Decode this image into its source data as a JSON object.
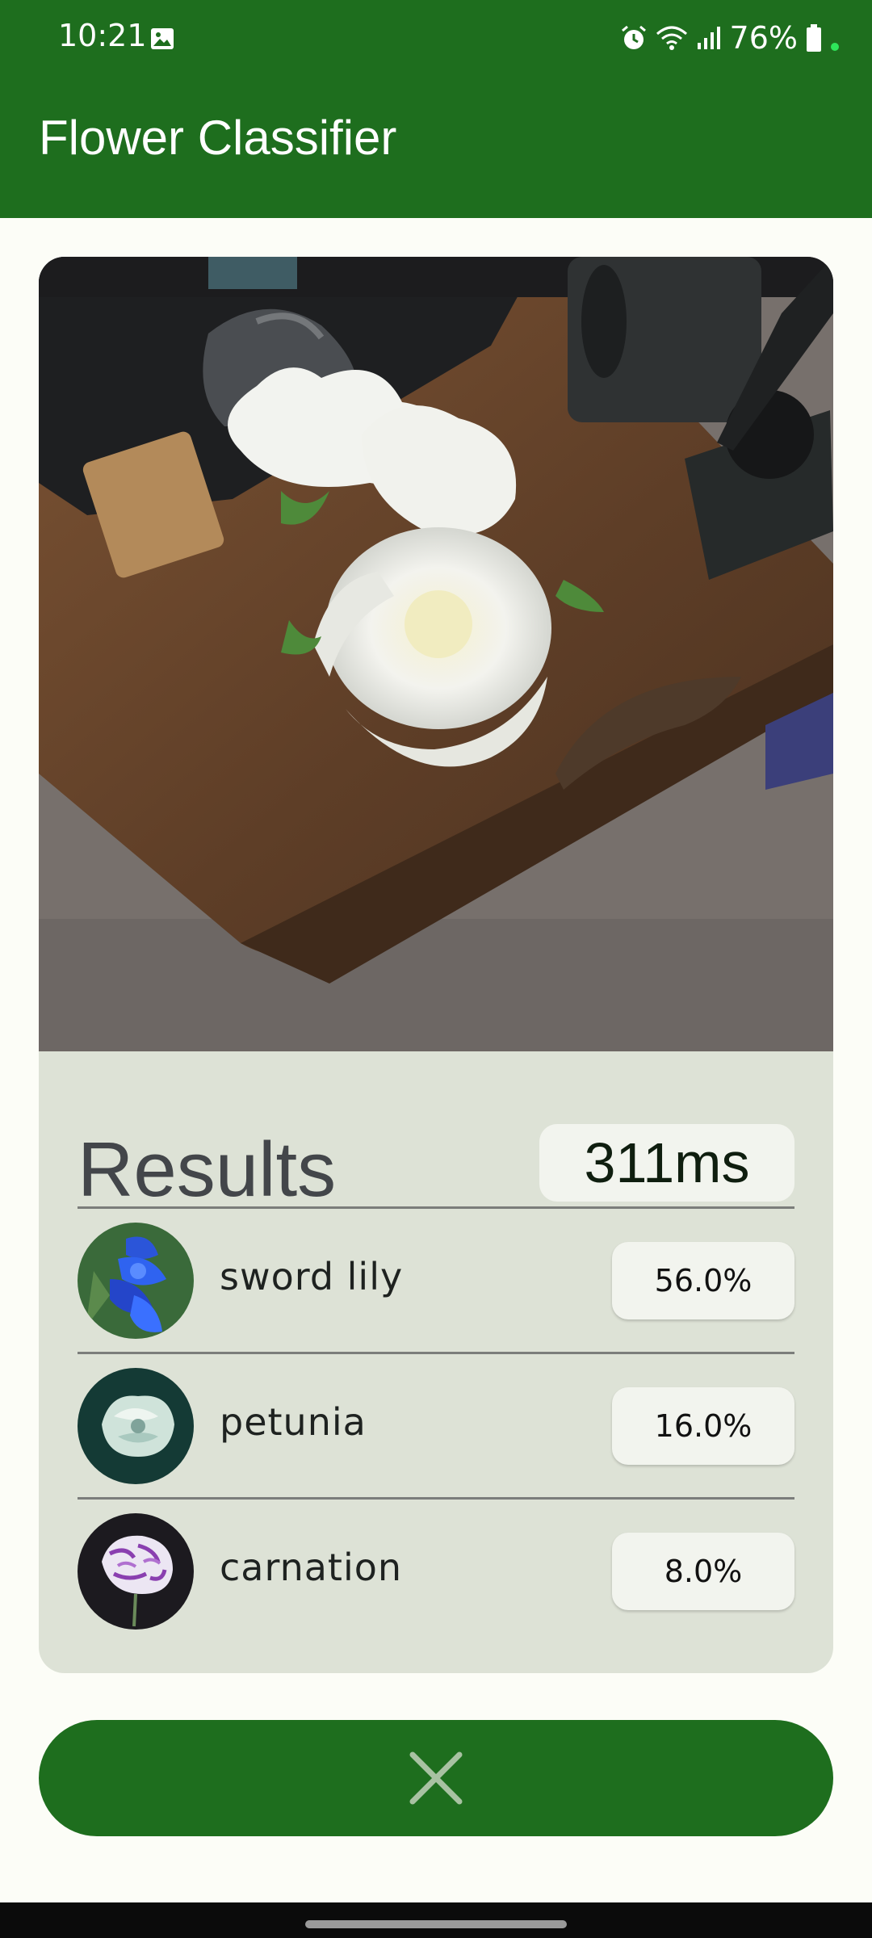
{
  "status_bar": {
    "time": "10:21",
    "battery_text": "76%",
    "icons": [
      "photo-icon",
      "alarm-icon",
      "wifi-icon",
      "signal-icon",
      "battery-icon"
    ]
  },
  "app_bar": {
    "title": "Flower Classifier"
  },
  "results": {
    "title": "Results",
    "inference_time": "311ms",
    "items": [
      {
        "label": "sword lily",
        "confidence": "56.0%"
      },
      {
        "label": "petunia",
        "confidence": "16.0%"
      },
      {
        "label": "carnation",
        "confidence": "8.0%"
      }
    ]
  },
  "colors": {
    "primary": "#1e6e1e",
    "card_background": "#dde2d6",
    "pill_background": "#f2f4ee",
    "page_background": "#fcfdf7"
  },
  "close_button": {
    "icon": "close-icon"
  }
}
